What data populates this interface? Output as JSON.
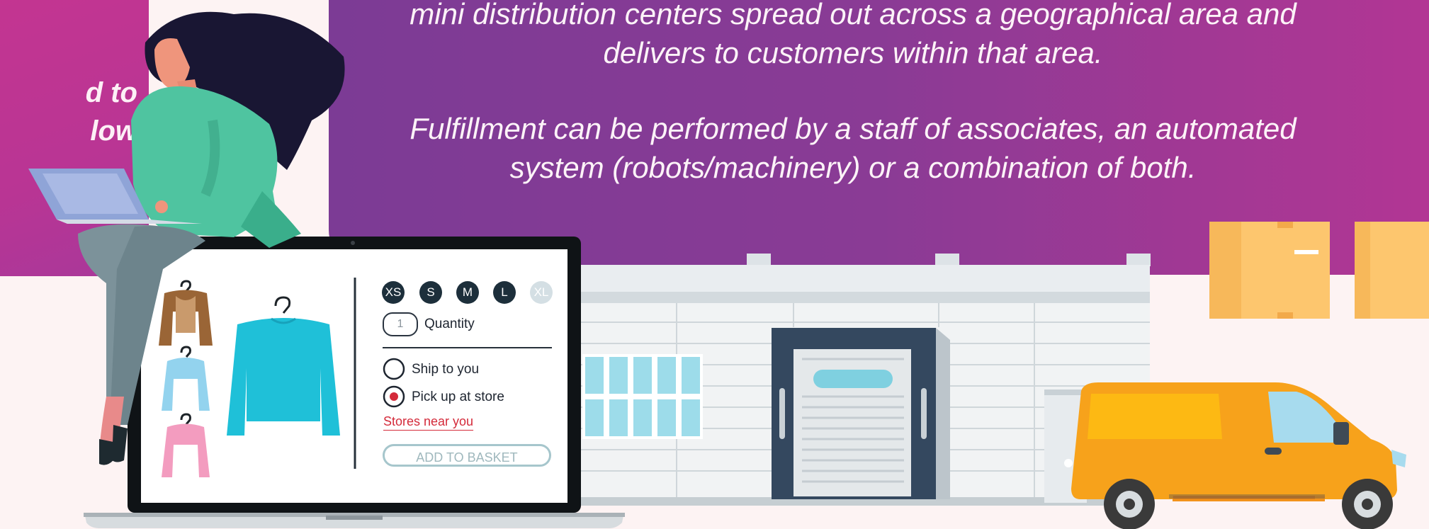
{
  "left_banner": {
    "lines": [
      "d to",
      "low"
    ]
  },
  "main_banner": {
    "paragraph1": [
      "mini distribution centers spread out across a geographical area and",
      "delivers to customers within that area."
    ],
    "paragraph2": [
      "Fulfillment can be performed by a staff of associates, an automated",
      "system (robots/machinery) or a combination of both."
    ]
  },
  "shop_ui": {
    "sizes": [
      "XS",
      "S",
      "M",
      "L",
      "XL"
    ],
    "quantity_value": "1",
    "quantity_label": "Quantity",
    "options": [
      {
        "label": "Ship to you",
        "selected": false
      },
      {
        "label": "Pick up at store",
        "selected": true
      }
    ],
    "stores_link": "Stores near you",
    "add_to_basket": "ADD TO BASKET"
  },
  "colors": {
    "banner_start": "#7c3b95",
    "banner_end": "#b23694",
    "left_banner": "#c33591",
    "accent_red": "#d42a3a",
    "sweater_blue": "#1fc0d8",
    "van_orange": "#f7a21b",
    "box_tan": "#fdc66e"
  }
}
